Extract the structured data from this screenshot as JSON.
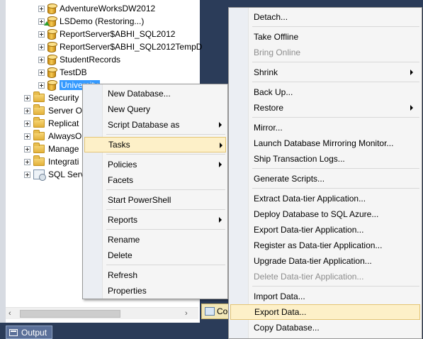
{
  "tree": {
    "databases": [
      {
        "label": "AdventureWorksDW2012",
        "state": "normal"
      },
      {
        "label": "LSDemo (Restoring...)",
        "state": "restoring"
      },
      {
        "label": "ReportServer$ABHI_SQL2012",
        "state": "normal"
      },
      {
        "label": "ReportServer$ABHI_SQL2012TempD",
        "state": "normal"
      },
      {
        "label": "StudentRecords",
        "state": "normal"
      },
      {
        "label": "TestDB",
        "state": "normal"
      },
      {
        "label": "University",
        "state": "selected"
      }
    ],
    "folders": [
      {
        "label": "Security"
      },
      {
        "label": "Server O"
      },
      {
        "label": "Replicat"
      },
      {
        "label": "AlwaysO"
      },
      {
        "label": "Manage"
      },
      {
        "label": "Integrati"
      },
      {
        "label": "SQL Serv"
      }
    ]
  },
  "scrollbar": {
    "left_icon": "arrow-left-icon",
    "right_icon": "arrow-right-icon",
    "left_glyph": "‹",
    "right_glyph": "›"
  },
  "status": {
    "co_label": "Co"
  },
  "output_tab": {
    "label": "Output",
    "icon": "output-window-icon"
  },
  "db_context_menu": {
    "items": [
      {
        "label": "New Database...",
        "submenu": false
      },
      {
        "label": "New Query",
        "submenu": false
      },
      {
        "label": "Script Database as",
        "submenu": true
      },
      {
        "label": "Tasks",
        "submenu": true,
        "highlighted": true
      },
      {
        "label": "Policies",
        "submenu": true
      },
      {
        "label": "Facets",
        "submenu": false
      },
      {
        "label": "Start PowerShell",
        "submenu": false
      },
      {
        "label": "Reports",
        "submenu": true
      },
      {
        "label": "Rename",
        "submenu": false
      },
      {
        "label": "Delete",
        "submenu": false
      },
      {
        "label": "Refresh",
        "submenu": false
      },
      {
        "label": "Properties",
        "submenu": false
      }
    ]
  },
  "tasks_submenu": {
    "items": [
      {
        "label": "Detach...",
        "enabled": true
      },
      {
        "label": "Take Offline",
        "enabled": true
      },
      {
        "label": "Bring Online",
        "enabled": false
      },
      {
        "label": "Shrink",
        "enabled": true,
        "submenu": true
      },
      {
        "label": "Back Up...",
        "enabled": true
      },
      {
        "label": "Restore",
        "enabled": true,
        "submenu": true
      },
      {
        "label": "Mirror...",
        "enabled": true
      },
      {
        "label": "Launch Database Mirroring Monitor...",
        "enabled": true
      },
      {
        "label": "Ship Transaction Logs...",
        "enabled": true
      },
      {
        "label": "Generate Scripts...",
        "enabled": true
      },
      {
        "label": "Extract Data-tier Application...",
        "enabled": true
      },
      {
        "label": "Deploy Database to SQL Azure...",
        "enabled": true
      },
      {
        "label": "Export Data-tier Application...",
        "enabled": true
      },
      {
        "label": "Register as Data-tier Application...",
        "enabled": true
      },
      {
        "label": "Upgrade Data-tier Application...",
        "enabled": true
      },
      {
        "label": "Delete Data-tier Application...",
        "enabled": false
      },
      {
        "label": "Import Data...",
        "enabled": true
      },
      {
        "label": "Export Data...",
        "enabled": true,
        "highlighted": true
      },
      {
        "label": "Copy Database...",
        "enabled": true
      }
    ]
  }
}
